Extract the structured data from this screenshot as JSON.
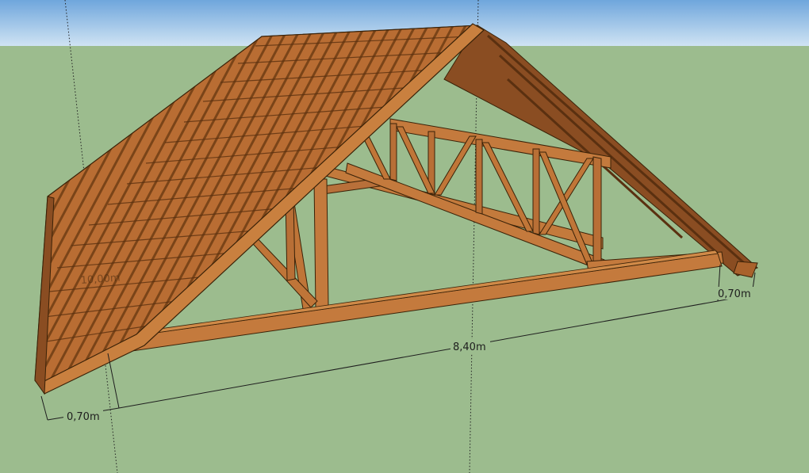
{
  "colors": {
    "sky": "#9dc4e6",
    "ground": "#9cbc8e",
    "timber_light": "#c8773a",
    "timber_mid": "#b06a30",
    "timber_dark": "#7a4418",
    "edge": "#3a2208"
  },
  "dimensions": {
    "left_overhang": "0,70m",
    "span": "8,40m",
    "right_overhang": "0,70m",
    "hidden_label": "10,00m"
  }
}
